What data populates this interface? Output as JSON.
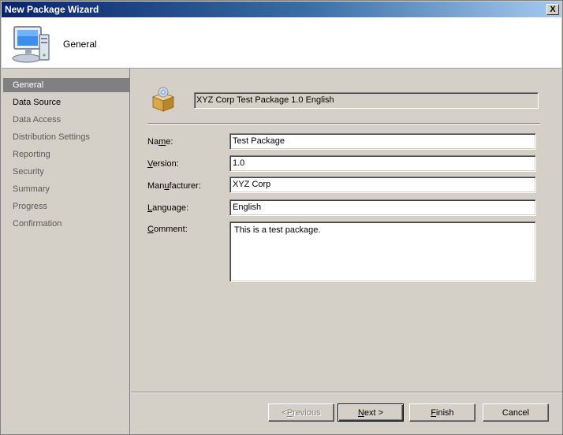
{
  "window": {
    "title": "New Package Wizard",
    "close_glyph": "X"
  },
  "header": {
    "title": "General",
    "icon": "computer-icon"
  },
  "sidebar": {
    "items": [
      {
        "label": "General",
        "state": "active"
      },
      {
        "label": "Data Source",
        "state": "normal"
      },
      {
        "label": "Data Access",
        "state": "future"
      },
      {
        "label": "Distribution Settings",
        "state": "future"
      },
      {
        "label": "Reporting",
        "state": "future"
      },
      {
        "label": "Security",
        "state": "future"
      },
      {
        "label": "Summary",
        "state": "future"
      },
      {
        "label": "Progress",
        "state": "future"
      },
      {
        "label": "Confirmation",
        "state": "future"
      }
    ]
  },
  "package": {
    "display_name": "XYZ Corp Test Package 1.0 English",
    "icon": "package-icon"
  },
  "form": {
    "name": {
      "label_pre": "Na",
      "label_key": "m",
      "label_post": "e:",
      "value": "Test Package"
    },
    "version": {
      "label_pre": "",
      "label_key": "V",
      "label_post": "ersion:",
      "value": "1.0"
    },
    "manufacturer": {
      "label_pre": "Man",
      "label_key": "u",
      "label_post": "facturer:",
      "value": "XYZ Corp"
    },
    "language": {
      "label_pre": "",
      "label_key": "L",
      "label_post": "anguage:",
      "value": "English"
    },
    "comment": {
      "label_pre": "",
      "label_key": "C",
      "label_post": "omment:",
      "value": "This is a test package."
    }
  },
  "buttons": {
    "previous": {
      "prefix": "< ",
      "key": "P",
      "rest": "revious"
    },
    "next": {
      "key": "N",
      "rest": "ext >"
    },
    "finish": {
      "key": "F",
      "rest": "inish"
    },
    "cancel": {
      "label": "Cancel"
    }
  }
}
